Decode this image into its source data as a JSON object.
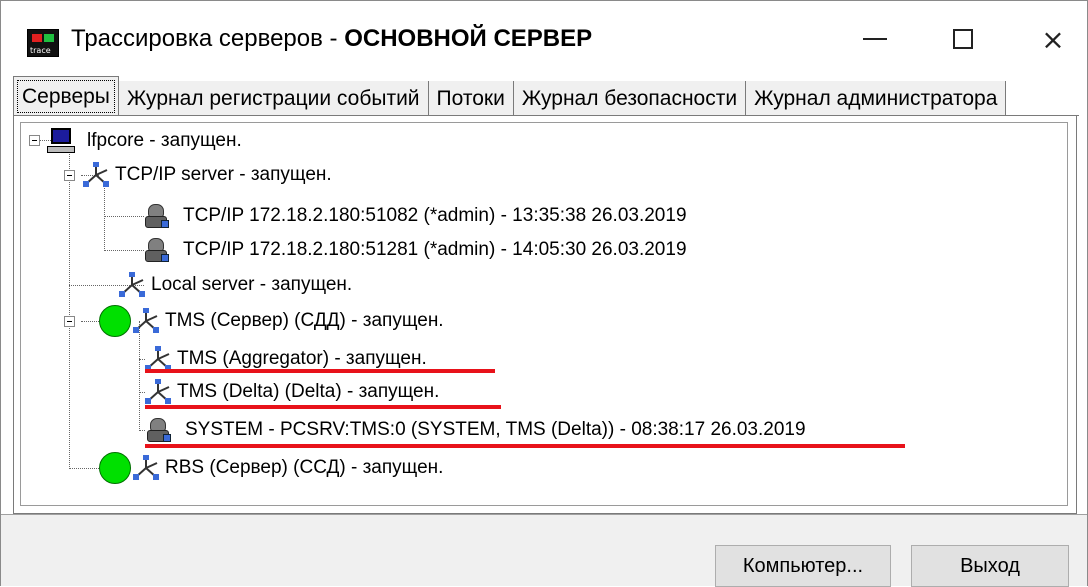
{
  "window": {
    "title_prefix": "Трассировка серверов - ",
    "title_server": "ОСНОВНОЙ СЕРВЕР",
    "icon_label": "trace",
    "controls": {
      "minimize": "minimize-icon",
      "maximize": "maximize-icon",
      "close": "×"
    }
  },
  "tabs": [
    {
      "label": "Серверы",
      "active": true
    },
    {
      "label": "Журнал регистрации событий",
      "active": false
    },
    {
      "label": "Потоки",
      "active": false
    },
    {
      "label": "Журнал безопасности",
      "active": false
    },
    {
      "label": "Журнал администратора",
      "active": false
    }
  ],
  "tree": {
    "root": {
      "label": "lfpcore   - запущен."
    },
    "tcp": {
      "label": "TCP/IP server   - запущен."
    },
    "tcp_conn1": {
      "label": "TCP/IP 172.18.2.180:51082 (*admin) - 13:35:38  26.03.2019"
    },
    "tcp_conn2": {
      "label": "TCP/IP 172.18.2.180:51281 (*admin) - 14:05:30  26.03.2019"
    },
    "local": {
      "label": "Local server   - запущен."
    },
    "tms": {
      "label": "TMS (Сервер) (СДД)  - запущен."
    },
    "tms_agg": {
      "label": "TMS (Aggregator)   - запущен."
    },
    "tms_delta": {
      "label": "TMS (Delta) (Delta)  - запущен."
    },
    "tms_system": {
      "label": "SYSTEM - PCSRV:TMS:0 (SYSTEM, TMS (Delta)) - 08:38:17  26.03.2019"
    },
    "rbs": {
      "label": "RBS (Сервер) (ССД)  - запущен."
    }
  },
  "colors": {
    "highlight_underline": "#e8121a",
    "status_green": "#00e000"
  },
  "buttons": {
    "computer": "Компьютер...",
    "exit": "Выход"
  }
}
